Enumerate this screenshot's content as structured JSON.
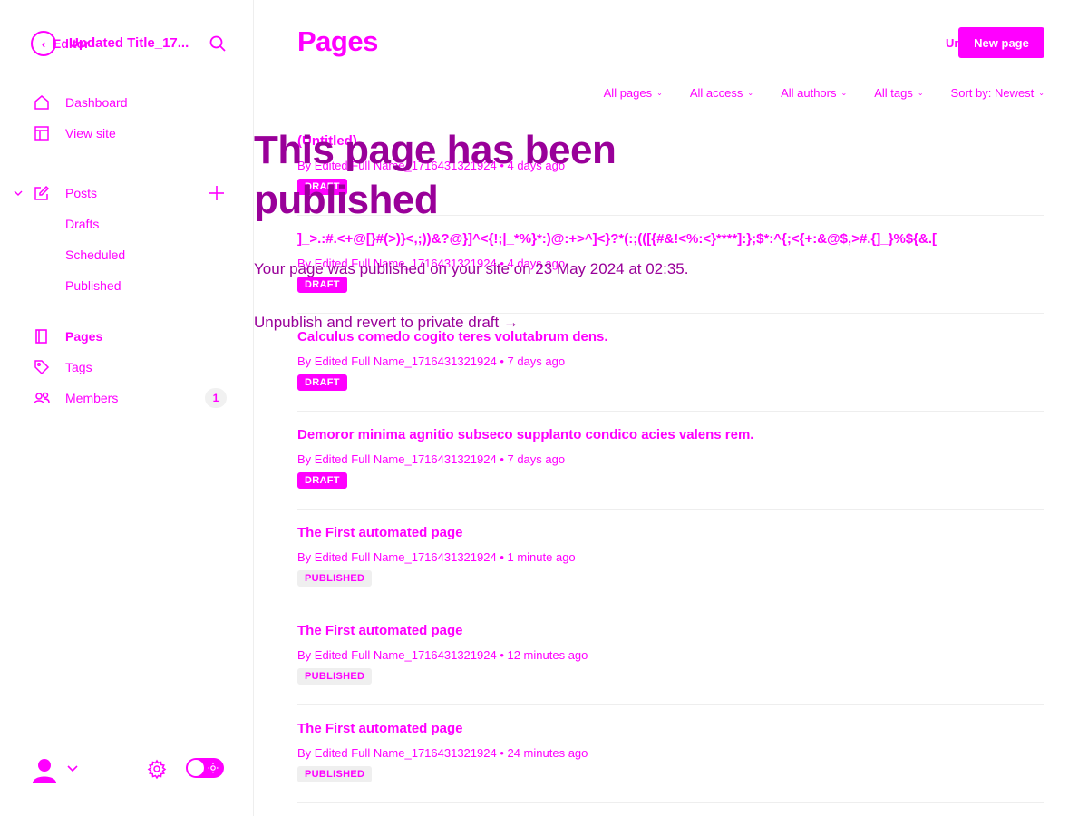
{
  "sidebar": {
    "back_label": "Editor",
    "site_title": "Updated Title_17...",
    "nav": {
      "dashboard": "Dashboard",
      "view_site": "View site",
      "posts": "Posts",
      "drafts": "Drafts",
      "scheduled": "Scheduled",
      "published": "Published",
      "pages": "Pages",
      "tags": "Tags",
      "members": "Members",
      "members_count": "1"
    }
  },
  "header": {
    "title": "Pages",
    "unpublished_label": "Unpublish",
    "new_page_button": "New page"
  },
  "filters": [
    "All pages",
    "All access",
    "All authors",
    "All tags",
    "Sort by: Newest"
  ],
  "pages": [
    {
      "title": "(Untitled)",
      "meta": "By Edited Full Name_1716431321924 • 4 days ago",
      "status": "DRAFT"
    },
    {
      "title": "]_>.:#.<+@[}#(>)}<,;))&?@}]^<{!;|_*%}*:)@:+>^]<}?*(:;(([{#&!<%:<}****]:};$*:^{;<{+:&@$,>#.{]_}%${&.[",
      "meta": "By Edited Full Name_1716431321924 • 4 days ago",
      "status": "DRAFT"
    },
    {
      "title": "Calculus comedo cogito teres volutabrum dens.",
      "meta": "By Edited Full Name_1716431321924 • 7 days ago",
      "status": "DRAFT"
    },
    {
      "title": "Demoror minima agnitio subseco supplanto condico acies valens rem.",
      "meta": "By Edited Full Name_1716431321924 • 7 days ago",
      "status": "DRAFT"
    },
    {
      "title": "The First automated page",
      "meta": "By Edited Full Name_1716431321924 • 1 minute ago",
      "status": "PUBLISHED"
    },
    {
      "title": "The First automated page",
      "meta": "By Edited Full Name_1716431321924 • 12 minutes ago",
      "status": "PUBLISHED"
    },
    {
      "title": "The First automated page",
      "meta": "By Edited Full Name_1716431321924 • 24 minutes ago",
      "status": "PUBLISHED"
    }
  ],
  "notice": {
    "heading": "This page has been published",
    "body": "Your page was published on your site on 23 May 2024 at 02:35.",
    "action": "Unpublish and revert to private draft →"
  },
  "colors": {
    "accent": "#ff00ff",
    "notice_text": "#990099",
    "published_badge_bg": "#efefef"
  },
  "icons": [
    "chevron-left-icon",
    "search-icon",
    "home-icon",
    "layout-icon",
    "edit-icon",
    "plus-icon",
    "page-icon",
    "tag-icon",
    "members-icon",
    "user-icon",
    "gear-icon",
    "sun-icon"
  ]
}
